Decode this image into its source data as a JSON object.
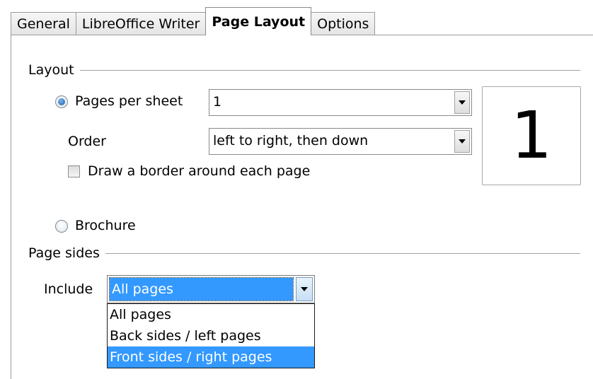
{
  "tabs": [
    {
      "label": "General",
      "active": false
    },
    {
      "label": "LibreOffice Writer",
      "active": false
    },
    {
      "label": "Page Layout",
      "active": true
    },
    {
      "label": "Options",
      "active": false
    }
  ],
  "layout": {
    "section_label": "Layout",
    "pages_per_sheet": {
      "label": "Pages per sheet",
      "selected": true,
      "value": "1"
    },
    "order": {
      "label": "Order",
      "value": "left to right, then down"
    },
    "draw_border": {
      "label": "Draw a border around each page",
      "checked": false
    },
    "preview_value": "1",
    "brochure": {
      "label": "Brochure",
      "selected": false
    }
  },
  "page_sides": {
    "section_label": "Page sides",
    "include": {
      "label": "Include",
      "value": "All pages",
      "options": [
        "All pages",
        "Back sides / left pages",
        "Front sides / right pages"
      ],
      "highlighted_option": "Front sides / right pages"
    }
  },
  "colors": {
    "selection": "#3399ff",
    "radio_dot": "#1c5ea8"
  }
}
